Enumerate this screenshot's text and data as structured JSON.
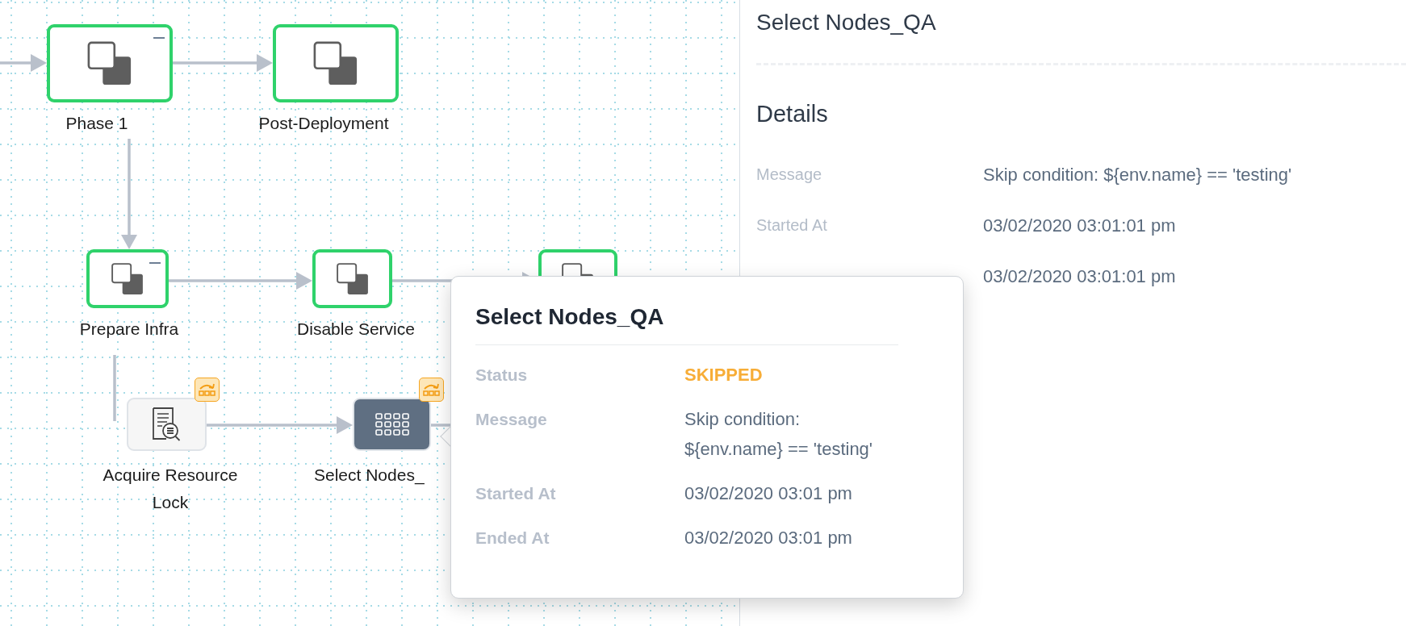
{
  "nodes": [
    {
      "kind": "phase",
      "label": "Phase 1",
      "succeeded": true,
      "collapsible": true
    },
    {
      "kind": "phase",
      "label": "Post-Deployment",
      "succeeded": true,
      "collapsible": false
    },
    {
      "kind": "phase",
      "label": "Prepare Infra",
      "succeeded": true,
      "collapsible": true
    },
    {
      "kind": "phase",
      "label": "Disable Service",
      "succeeded": true,
      "collapsible": false
    },
    {
      "kind": "phase",
      "succeeded": true,
      "collapsible": false
    },
    {
      "kind": "step",
      "label": "Acquire Resource Lock",
      "skipped": true,
      "selected": false
    },
    {
      "kind": "step",
      "label": "Select Nodes_",
      "skipped": true,
      "selected": true
    }
  ],
  "details_panel": {
    "title": "Select Nodes_QA",
    "section": "Details",
    "rows": [
      {
        "label": "Message",
        "value": "Skip condition: ${env.name} == 'testing'"
      },
      {
        "label": "Started At",
        "value": "03/02/2020 03:01:01 pm"
      },
      {
        "value": "03/02/2020 03:01:01 pm"
      }
    ]
  },
  "popover": {
    "title": "Select Nodes_QA",
    "rows": [
      {
        "kind": "status",
        "label": "Status",
        "value": "SKIPPED"
      },
      {
        "kind": "text",
        "label": "Message",
        "value": "Skip condition: ${env.name} == 'testing'"
      },
      {
        "kind": "text",
        "label": "Started At",
        "value": "03/02/2020 03:01 pm"
      },
      {
        "kind": "text",
        "label": "Ended At",
        "value": "03/02/2020 03:01 pm"
      }
    ]
  }
}
